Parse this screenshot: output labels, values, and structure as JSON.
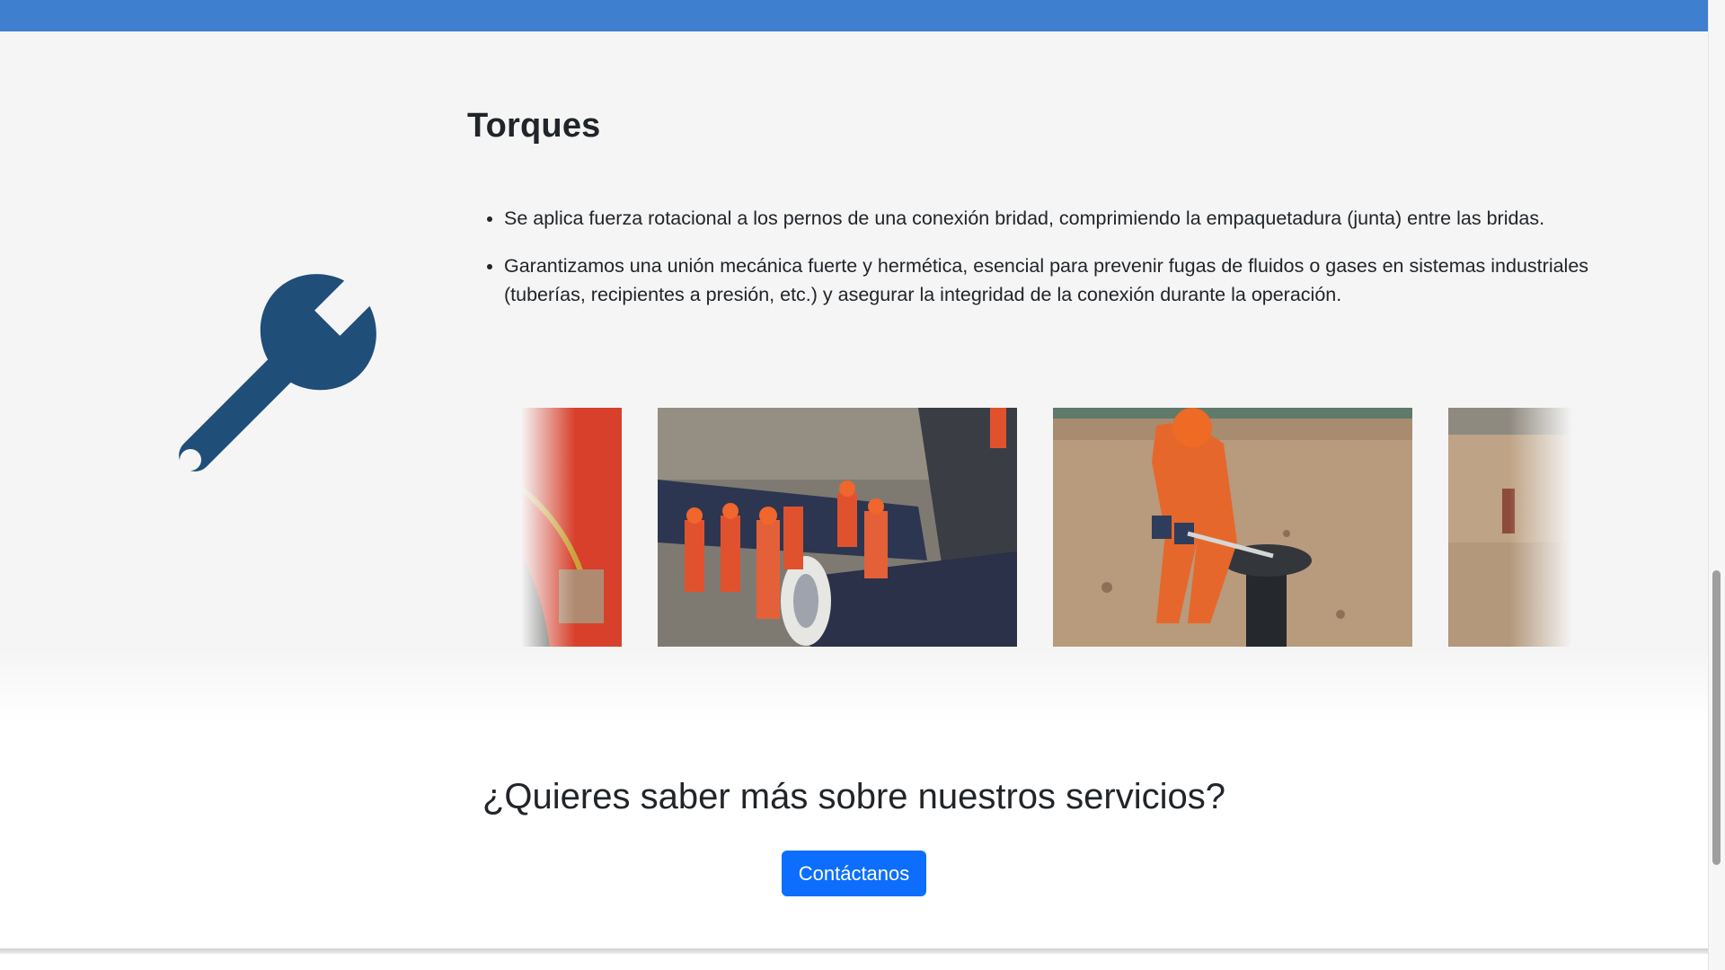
{
  "service": {
    "title": "Torques",
    "bullets": [
      "Se aplica fuerza rotacional a los pernos de una conexión bridad, comprimiendo la empaquetadura (junta) entre las bridas.",
      "Garantizamos una unión mecánica fuerte y hermética, esencial para prevenir fugas de fluidos o gases en sistemas industriales (tuberías, recipientes a presión, etc.) y asegurar la integridad de la conexión durante la operación."
    ],
    "icon": "wrench-icon",
    "icon_color": "#1f4e79"
  },
  "gallery": {
    "images": [
      {
        "name": "gallery-image-workers-pipe-closeup"
      },
      {
        "name": "gallery-image-pipeline-flange-crew"
      },
      {
        "name": "gallery-image-worker-torque-wrench"
      },
      {
        "name": "gallery-image-construction-site"
      }
    ]
  },
  "cta": {
    "heading": "¿Quieres saber más sobre nuestros servicios?",
    "button_label": "Contáctanos"
  },
  "colors": {
    "topbar": "#3f7fcf",
    "accent": "#0d6efd",
    "section_bg": "#f5f5f5"
  }
}
